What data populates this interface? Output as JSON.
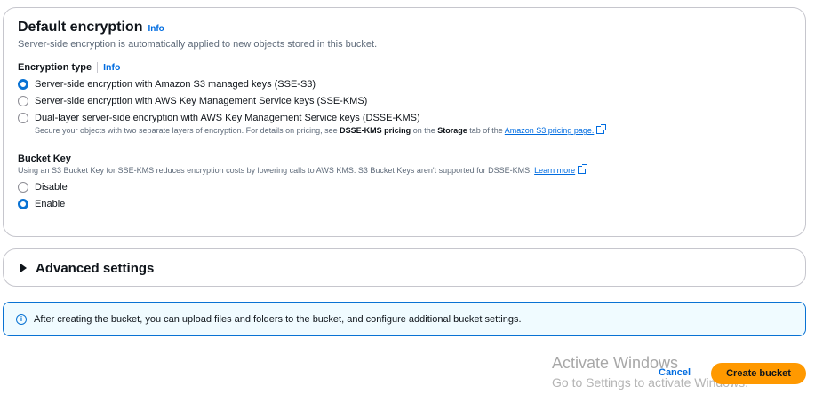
{
  "encryption": {
    "title": "Default encryption",
    "info": "Info",
    "description": "Server-side encryption is automatically applied to new objects stored in this bucket.",
    "type_label": "Encryption type",
    "type_info": "Info",
    "options": [
      {
        "label": "Server-side encryption with Amazon S3 managed keys (SSE-S3)",
        "checked": true
      },
      {
        "label": "Server-side encryption with AWS Key Management Service keys (SSE-KMS)",
        "checked": false
      },
      {
        "label": "Dual-layer server-side encryption with AWS Key Management Service keys (DSSE-KMS)",
        "checked": false
      }
    ],
    "dsse_note_prefix": "Secure your objects with two separate layers of encryption. For details on pricing, see ",
    "dsse_note_bold1": "DSSE-KMS pricing",
    "dsse_note_mid": " on the ",
    "dsse_note_bold2": "Storage",
    "dsse_note_mid2": " tab of the ",
    "dsse_note_link": "Amazon S3 pricing page.",
    "bucket_key_label": "Bucket Key",
    "bucket_key_desc": "Using an S3 Bucket Key for SSE-KMS reduces encryption costs by lowering calls to AWS KMS. S3 Bucket Keys aren't supported for DSSE-KMS. ",
    "bucket_key_link": "Learn more",
    "bucket_key_options": [
      {
        "label": "Disable",
        "checked": false
      },
      {
        "label": "Enable",
        "checked": true
      }
    ]
  },
  "advanced": {
    "title": "Advanced settings"
  },
  "alert": {
    "icon": "info-circle-icon",
    "text": "After creating the bucket, you can upload files and folders to the bucket, and configure additional bucket settings."
  },
  "watermark": {
    "line1": "Activate Windows",
    "line2": "Go to Settings to activate Windows."
  },
  "actions": {
    "cancel": "Cancel",
    "create": "Create bucket"
  },
  "colors": {
    "accent": "#0972d3",
    "primary_button": "#ff9900",
    "link": "#006ce0"
  }
}
